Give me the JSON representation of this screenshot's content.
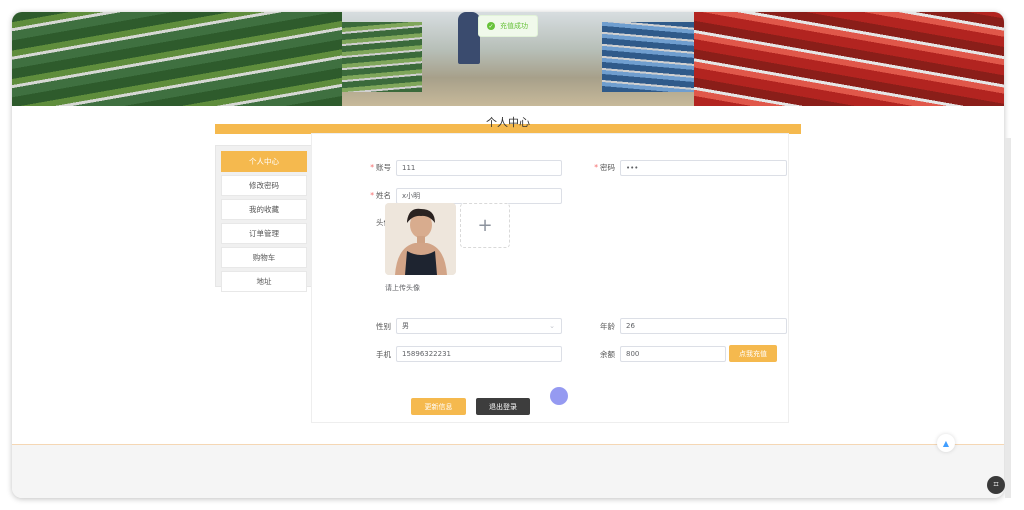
{
  "toast": {
    "message": "充值成功",
    "icon": "check-circle-icon",
    "color": "#67c23a"
  },
  "page": {
    "title": "个人中心",
    "accent": "#f5b94e"
  },
  "sidebar": {
    "items": [
      {
        "label": "个人中心",
        "active": true
      },
      {
        "label": "修改密码"
      },
      {
        "label": "我的收藏"
      },
      {
        "label": "订单管理"
      },
      {
        "label": "购物车"
      },
      {
        "label": "地址"
      }
    ]
  },
  "form": {
    "account": {
      "label": "账号",
      "value": "111"
    },
    "password": {
      "label": "密码",
      "value": "•••"
    },
    "name": {
      "label": "姓名",
      "value": "x小明"
    },
    "avatar": {
      "label": "头像",
      "hint": "请上传头像",
      "add_icon": "plus-icon"
    },
    "gender": {
      "label": "性别",
      "value": "男",
      "icon": "chevron-down-icon"
    },
    "age": {
      "label": "年龄",
      "value": "26"
    },
    "phone": {
      "label": "手机",
      "value": "15896322231"
    },
    "balance": {
      "label": "余额",
      "value": "800",
      "recharge": "点我充值"
    }
  },
  "actions": {
    "update": "更新信息",
    "logout": "退出登录"
  },
  "backtop_icon": "caret-up-icon",
  "corner_icon": "screenshot-icon"
}
